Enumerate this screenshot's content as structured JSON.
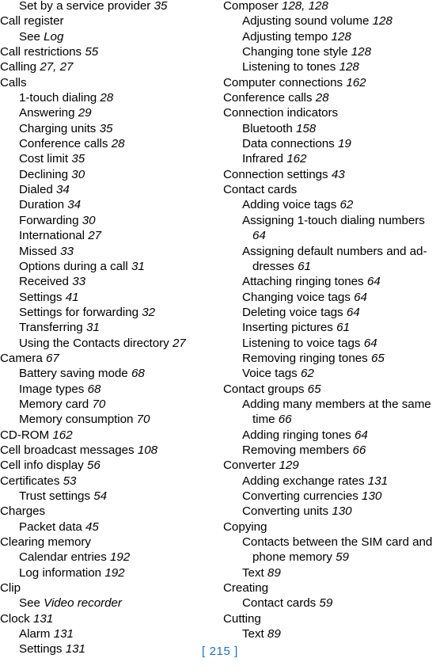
{
  "page": {
    "folio": "[ 215 ]",
    "folio_number": "215",
    "folio_color": "#1a6fd8",
    "text_color": "#000000",
    "background_color": "#ffffff"
  },
  "columns": [
    {
      "name": "left-column",
      "entries": [
        {
          "level": 1,
          "text": "Set by a service provider ",
          "page": "35"
        },
        {
          "level": 0,
          "text": "Call register",
          "page": ""
        },
        {
          "level": 1,
          "text": "See ",
          "xref": "Log"
        },
        {
          "level": 0,
          "text": "Call restrictions ",
          "page": "55"
        },
        {
          "level": 0,
          "text": "Calling ",
          "page": "27, 27"
        },
        {
          "level": 0,
          "text": "Calls",
          "page": ""
        },
        {
          "level": 1,
          "text": "1-touch dialing ",
          "page": "28"
        },
        {
          "level": 1,
          "text": "Answering ",
          "page": "29"
        },
        {
          "level": 1,
          "text": "Charging units ",
          "page": "35"
        },
        {
          "level": 1,
          "text": "Conference calls ",
          "page": "28"
        },
        {
          "level": 1,
          "text": "Cost limit ",
          "page": "35"
        },
        {
          "level": 1,
          "text": "Declining ",
          "page": "30"
        },
        {
          "level": 1,
          "text": "Dialed ",
          "page": "34"
        },
        {
          "level": 1,
          "text": "Duration ",
          "page": "34"
        },
        {
          "level": 1,
          "text": "Forwarding ",
          "page": "30"
        },
        {
          "level": 1,
          "text": "International ",
          "page": "27"
        },
        {
          "level": 1,
          "text": "Missed ",
          "page": "33"
        },
        {
          "level": 1,
          "text": "Options during a call ",
          "page": "31"
        },
        {
          "level": 1,
          "text": "Received ",
          "page": "33"
        },
        {
          "level": 1,
          "text": "Settings ",
          "page": "41"
        },
        {
          "level": 1,
          "text": "Settings for forwarding ",
          "page": "32"
        },
        {
          "level": 1,
          "text": "Transferring ",
          "page": "31"
        },
        {
          "level": 1,
          "text": "Using the Contacts directory ",
          "page": "27"
        },
        {
          "level": 0,
          "text": "Camera ",
          "page": "67"
        },
        {
          "level": 1,
          "text": "Battery saving mode ",
          "page": "68"
        },
        {
          "level": 1,
          "text": "Image types ",
          "page": "68"
        },
        {
          "level": 1,
          "text": "Memory card ",
          "page": "70"
        },
        {
          "level": 1,
          "text": "Memory consumption ",
          "page": "70"
        },
        {
          "level": 0,
          "text": "CD-ROM ",
          "page": "162"
        },
        {
          "level": 0,
          "text": "Cell broadcast messages ",
          "page": "108"
        },
        {
          "level": 0,
          "text": "Cell info display ",
          "page": "56"
        },
        {
          "level": 0,
          "text": "Certificates ",
          "page": "53"
        },
        {
          "level": 1,
          "text": "Trust settings ",
          "page": "54"
        },
        {
          "level": 0,
          "text": "Charges",
          "page": ""
        },
        {
          "level": 1,
          "text": "Packet data ",
          "page": "45"
        },
        {
          "level": 0,
          "text": "Clearing memory",
          "page": ""
        },
        {
          "level": 1,
          "text": "Calendar entries ",
          "page": "192"
        },
        {
          "level": 1,
          "text": "Log information ",
          "page": "192"
        },
        {
          "level": 0,
          "text": "Clip",
          "page": ""
        },
        {
          "level": 1,
          "text": "See ",
          "xref": "Video recorder"
        },
        {
          "level": 0,
          "text": "Clock ",
          "page": "131"
        },
        {
          "level": 1,
          "text": "Alarm ",
          "page": "131"
        },
        {
          "level": 1,
          "text": "Settings ",
          "page": "131"
        }
      ]
    },
    {
      "name": "right-column",
      "entries": [
        {
          "level": 0,
          "text": "Composer ",
          "page": "128, 128"
        },
        {
          "level": 1,
          "text": "Adjusting sound volume ",
          "page": "128"
        },
        {
          "level": 1,
          "text": "Adjusting tempo ",
          "page": "128"
        },
        {
          "level": 1,
          "text": "Changing tone style ",
          "page": "128"
        },
        {
          "level": 1,
          "text": "Listening to tones ",
          "page": "128"
        },
        {
          "level": 0,
          "text": "Computer connections ",
          "page": "162"
        },
        {
          "level": 0,
          "text": "Conference calls ",
          "page": "28"
        },
        {
          "level": 0,
          "text": "Connection indicators",
          "page": ""
        },
        {
          "level": 1,
          "text": "Bluetooth ",
          "page": "158"
        },
        {
          "level": 1,
          "text": "Data connections ",
          "page": "19"
        },
        {
          "level": 1,
          "text": "Infrared ",
          "page": "162"
        },
        {
          "level": 0,
          "text": "Connection settings ",
          "page": "43"
        },
        {
          "level": 0,
          "text": "Contact cards",
          "page": ""
        },
        {
          "level": 1,
          "text": "Adding voice tags ",
          "page": "62"
        },
        {
          "level": 1,
          "text": "Assigning 1-touch dialing numbers ",
          "page": "64"
        },
        {
          "level": 1,
          "text": "Assigning default numbers and ad-dresses ",
          "page": "61"
        },
        {
          "level": 1,
          "text": "Attaching ringing tones ",
          "page": "64"
        },
        {
          "level": 1,
          "text": "Changing voice tags ",
          "page": "64"
        },
        {
          "level": 1,
          "text": "Deleting voice tags ",
          "page": "64"
        },
        {
          "level": 1,
          "text": "Inserting pictures ",
          "page": "61"
        },
        {
          "level": 1,
          "text": "Listening to voice tags ",
          "page": "64"
        },
        {
          "level": 1,
          "text": "Removing ringing tones ",
          "page": "65"
        },
        {
          "level": 1,
          "text": "Voice tags ",
          "page": "62"
        },
        {
          "level": 0,
          "text": "Contact groups ",
          "page": "65"
        },
        {
          "level": 1,
          "text": "Adding many members at the same time ",
          "page": "66"
        },
        {
          "level": 1,
          "text": "Adding ringing tones ",
          "page": "64"
        },
        {
          "level": 1,
          "text": "Removing members ",
          "page": "66"
        },
        {
          "level": 0,
          "text": "Converter ",
          "page": "129"
        },
        {
          "level": 1,
          "text": "Adding exchange rates ",
          "page": "131"
        },
        {
          "level": 1,
          "text": "Converting currencies ",
          "page": "130"
        },
        {
          "level": 1,
          "text": "Converting units ",
          "page": "130"
        },
        {
          "level": 0,
          "text": "Copying",
          "page": ""
        },
        {
          "level": 1,
          "text": "Contacts between the SIM card and phone memory ",
          "page": "59"
        },
        {
          "level": 1,
          "text": "Text ",
          "page": "89"
        },
        {
          "level": 0,
          "text": "Creating",
          "page": ""
        },
        {
          "level": 1,
          "text": "Contact cards ",
          "page": "59"
        },
        {
          "level": 0,
          "text": "Cutting",
          "page": ""
        },
        {
          "level": 1,
          "text": "Text ",
          "page": "89"
        }
      ]
    }
  ]
}
